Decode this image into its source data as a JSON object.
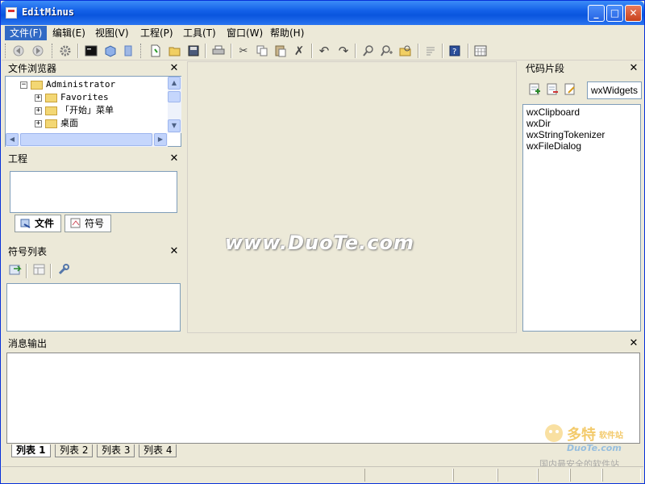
{
  "window": {
    "title": "EditMinus"
  },
  "titlebar_buttons": {
    "minimize": "_",
    "maximize": "□",
    "close": "✕"
  },
  "menu": [
    {
      "label": "文件(F)"
    },
    {
      "label": "编辑(E)"
    },
    {
      "label": "视图(V)"
    },
    {
      "label": "工程(P)"
    },
    {
      "label": "工具(T)"
    },
    {
      "label": "窗口(W)"
    },
    {
      "label": "帮助(H)"
    }
  ],
  "file_browser": {
    "title": "文件浏览器",
    "close": "✕",
    "tree": [
      {
        "label": "Administrator",
        "expander": "−"
      },
      {
        "label": "Favorites",
        "expander": "+"
      },
      {
        "label": "「开始」菜单",
        "expander": "+"
      },
      {
        "label": "桌面",
        "expander": "+"
      }
    ]
  },
  "project": {
    "title": "工程",
    "close": "✕",
    "tabs": [
      {
        "label": "文件"
      },
      {
        "label": "符号"
      }
    ]
  },
  "symbol_list": {
    "title": "符号列表",
    "close": "✕"
  },
  "snippets": {
    "title": "代码片段",
    "close": "✕",
    "combo_value": "wxWidgets",
    "items": [
      "wxClipboard",
      "wxDir",
      "wxStringTokenizer",
      "wxFileDialog"
    ]
  },
  "center": {
    "watermark": "www.DuoTe.com"
  },
  "output": {
    "title": "消息输出",
    "close": "✕",
    "tabs": [
      {
        "label": "列表 1"
      },
      {
        "label": "列表 2"
      },
      {
        "label": "列表 3"
      },
      {
        "label": "列表 4"
      }
    ]
  },
  "logo": {
    "name": "多特",
    "suffix": "软件站",
    "site": "DuoTe.com",
    "slogan": "国内最安全的软件站"
  },
  "colors": {
    "titlebar": "#0a55de",
    "selection": "#316ac5",
    "chrome": "#ece9d8"
  }
}
